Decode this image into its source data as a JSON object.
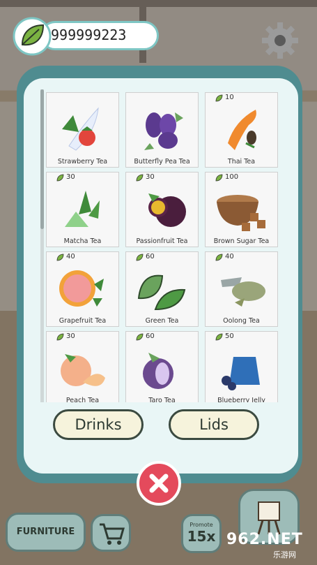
{
  "currency": {
    "amount": "999999223",
    "icon": "leaf-icon"
  },
  "menu": {
    "cards": [
      {
        "name": "Strawberry Tea",
        "price": ""
      },
      {
        "name": "Butterfly Pea Tea",
        "price": ""
      },
      {
        "name": "Thai Tea",
        "price": "10"
      },
      {
        "name": "Matcha Tea",
        "price": "30"
      },
      {
        "name": "Passionfruit Tea",
        "price": "30"
      },
      {
        "name": "Brown Sugar Tea",
        "price": "100"
      },
      {
        "name": "Grapefruit Tea",
        "price": "40"
      },
      {
        "name": "Green Tea",
        "price": "60"
      },
      {
        "name": "Oolong Tea",
        "price": "40"
      },
      {
        "name": "Peach Tea",
        "price": "30"
      },
      {
        "name": "Taro Tea",
        "price": "60"
      },
      {
        "name": "Blueberry Jelly",
        "price": "50"
      }
    ]
  },
  "tabs": {
    "drinks": "Drinks",
    "lids": "Lids"
  },
  "bottom": {
    "furniture": "FURNITURE",
    "promote_label": "Promote",
    "promote_value": "15x"
  },
  "watermark": {
    "text": "962.NET",
    "sub": "乐游网"
  },
  "colors": {
    "modal": "#4f8c90",
    "panel": "#e9f6f6",
    "close": "#e44a5c",
    "tab": "#f6f3dc"
  }
}
